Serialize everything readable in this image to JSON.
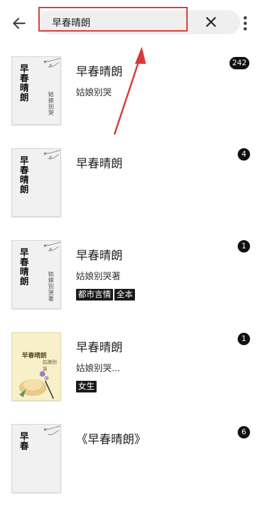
{
  "search": {
    "value": "早春晴朗"
  },
  "results": [
    {
      "cover_title": "早春晴朗",
      "cover_author": "姑娘别哭",
      "title": "早春晴朗",
      "author": "姑娘别哭",
      "tags": [],
      "count": "242"
    },
    {
      "cover_title": "早春晴朗",
      "cover_author": "",
      "title": "早春晴朗",
      "author": "",
      "tags": [],
      "count": "4"
    },
    {
      "cover_title": "早春晴朗",
      "cover_author": "姑娘别哭著",
      "title": "早春晴朗",
      "author": "姑娘别哭著",
      "tags": [
        "都市言情",
        "全本"
      ],
      "count": "1"
    },
    {
      "cover_title": "早春晴朗",
      "cover_author": "姑娘别哭",
      "title": "早春晴朗",
      "author": "姑娘别哭...",
      "tags": [
        "女生"
      ],
      "count": "1"
    },
    {
      "cover_title": "早春",
      "cover_author": "",
      "title": "《早春晴朗》",
      "author": "",
      "tags": [],
      "count": "6"
    }
  ],
  "colors": {
    "highlight": "#d9383a",
    "tag_bg": "#1a1a1a"
  }
}
